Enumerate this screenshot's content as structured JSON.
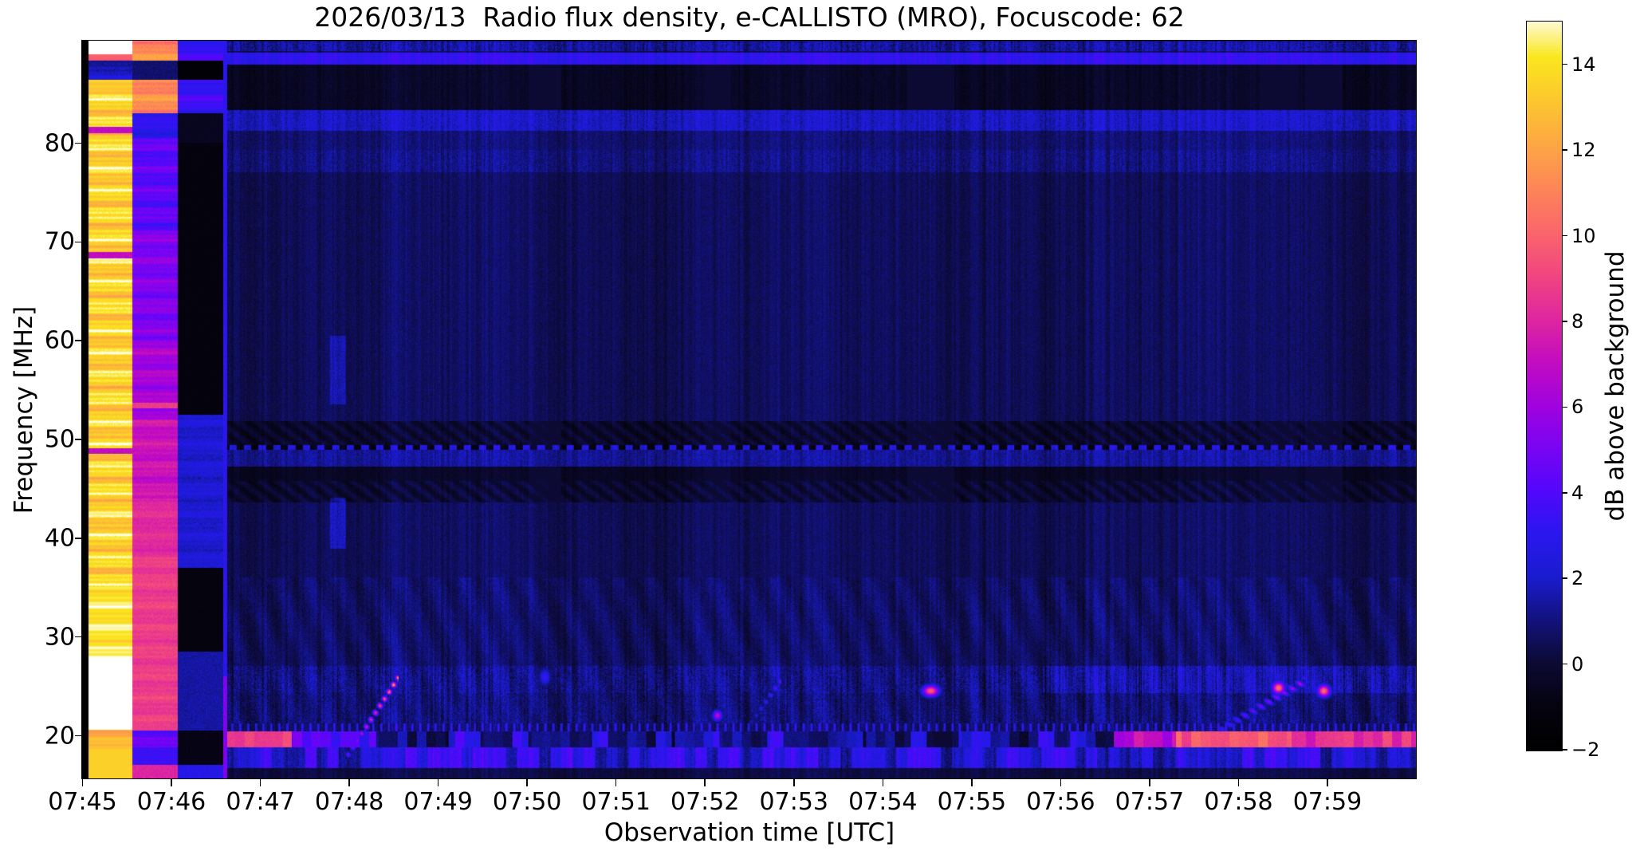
{
  "chart_data": {
    "type": "heatmap",
    "subtype": "radio-spectrogram",
    "title": "2026/03/13  Radio flux density, e-CALLISTO (MRO), Focuscode: 62",
    "xlabel": "Observation time [UTC]",
    "ylabel": "Frequency [MHz]",
    "colorbar_label": "dB above background",
    "x_tick_labels": [
      "07:45",
      "07:46",
      "07:47",
      "07:48",
      "07:49",
      "07:50",
      "07:51",
      "07:52",
      "07:53",
      "07:54",
      "07:55",
      "07:56",
      "07:57",
      "07:58",
      "07:59"
    ],
    "x_range_minutes": 15,
    "time_start": "07:45",
    "time_end": "08:00",
    "y_tick_values": [
      20,
      30,
      40,
      50,
      60,
      70,
      80
    ],
    "freq_range_mhz": [
      15.6,
      90.3
    ],
    "colorbar_tick_values": [
      14,
      12,
      10,
      8,
      6,
      4,
      2,
      0,
      -2
    ],
    "value_range_db": [
      -2,
      15
    ],
    "grid": false,
    "background_level_db": 0.55,
    "colormap_stops": [
      {
        "t": 0.0,
        "c": "#000000"
      },
      {
        "t": 0.06,
        "c": "#05030f"
      },
      {
        "t": 0.118,
        "c": "#0c0a33"
      },
      {
        "t": 0.176,
        "c": "#12127c"
      },
      {
        "t": 0.235,
        "c": "#1a1ccf"
      },
      {
        "t": 0.294,
        "c": "#2a17ef"
      },
      {
        "t": 0.353,
        "c": "#5407fb"
      },
      {
        "t": 0.412,
        "c": "#7b04f2"
      },
      {
        "t": 0.471,
        "c": "#a202dd"
      },
      {
        "t": 0.529,
        "c": "#c40dbf"
      },
      {
        "t": 0.588,
        "c": "#e0289e"
      },
      {
        "t": 0.647,
        "c": "#f1477f"
      },
      {
        "t": 0.706,
        "c": "#fb676b"
      },
      {
        "t": 0.765,
        "c": "#fd8756"
      },
      {
        "t": 0.824,
        "c": "#fda843"
      },
      {
        "t": 0.882,
        "c": "#fcc72e"
      },
      {
        "t": 0.941,
        "c": "#fae71e"
      },
      {
        "t": 1.0,
        "c": "#ffffff"
      }
    ],
    "features": {
      "calibration_columns": [
        {
          "t": [
            0.0,
            0.07
          ],
          "type": "black_edge"
        },
        {
          "t": [
            0.07,
            0.56
          ],
          "type": "saturated_white"
        },
        {
          "t": [
            0.56,
            1.07
          ],
          "type": "orange_magenta"
        },
        {
          "t": [
            1.07,
            1.58
          ],
          "type": "dark_blue_black"
        },
        {
          "t": [
            1.58,
            1.63
          ],
          "type": "blue_line"
        }
      ],
      "bands": [
        {
          "f": [
            89.3,
            90.3
          ],
          "amp": 0.9,
          "tex": 1.3
        },
        {
          "f": [
            87.9,
            89.1
          ],
          "amp": 2.6,
          "tex": 0.8
        },
        {
          "f": [
            83.3,
            87.9
          ],
          "amp": -0.9,
          "tex": 0.5
        },
        {
          "f": [
            81.2,
            83.3
          ],
          "amp": 1.4,
          "tex": 1.0
        },
        {
          "f": [
            79.3,
            81.2
          ],
          "amp": 0.3,
          "tex": 0.7
        },
        {
          "f": [
            77.0,
            79.3
          ],
          "amp": 0.5,
          "tex": 0.9
        },
        {
          "f": [
            51.8,
            77.0
          ],
          "amp": 0.0,
          "tex": 0.6
        },
        {
          "f": [
            49.4,
            51.8
          ],
          "amp": -0.35,
          "tex": 0.5,
          "herring": true
        },
        {
          "f": [
            48.9,
            49.4
          ],
          "amp": 0.5,
          "tex": 0.5,
          "dashed": true
        },
        {
          "f": [
            47.2,
            48.9
          ],
          "amp": 0.8,
          "tex": 0.8
        },
        {
          "f": [
            45.8,
            47.2
          ],
          "amp": -0.9,
          "tex": 0.4
        },
        {
          "f": [
            43.6,
            45.8
          ],
          "amp": -0.25,
          "tex": 0.5,
          "herring": true
        },
        {
          "f": [
            36.0,
            43.6
          ],
          "amp": 0.0,
          "tex": 0.6
        },
        {
          "f": [
            27.0,
            36.0
          ],
          "amp": 0.15,
          "tex": 0.8,
          "diag": true
        },
        {
          "f": [
            24.3,
            27.0
          ],
          "amp": 0.55,
          "tex": 1.3,
          "diag": true,
          "late_boost": 1.0
        },
        {
          "f": [
            21.2,
            24.3
          ],
          "amp": 0.35,
          "tex": 1.1,
          "diag": true
        },
        {
          "f": [
            20.4,
            21.2
          ],
          "amp": 0.6,
          "tex": 0.8,
          "blips": true
        },
        {
          "f": [
            18.8,
            20.4
          ],
          "amp": 0.0,
          "tex": 0.6,
          "lowband": true
        },
        {
          "f": [
            16.7,
            18.8
          ],
          "amp": 1.4,
          "tex": 1.0,
          "blocks": true
        },
        {
          "f": [
            15.6,
            16.7
          ],
          "amp": -0.3,
          "tex": 0.5
        }
      ],
      "lowband_segments": [
        {
          "t": [
            1.58,
            2.35
          ],
          "level": 9.0
        },
        {
          "t": [
            2.35,
            3.3
          ],
          "level": 4.0
        },
        {
          "t": [
            3.3,
            11.6
          ],
          "level": 0.8
        },
        {
          "t": [
            11.6,
            12.3
          ],
          "level": 7.0
        },
        {
          "t": [
            12.3,
            13.6
          ],
          "level": 9.8
        },
        {
          "t": [
            13.6,
            15.0
          ],
          "level": 8.3
        }
      ],
      "bursts": [
        {
          "t": [
            2.95,
            3.55
          ],
          "f": [
            17.5,
            25.8
          ],
          "amp": 12.0,
          "type": "typeIII"
        },
        {
          "t": [
            7.5,
            7.85
          ],
          "f": [
            21.0,
            25.5
          ],
          "amp": 4.5,
          "type": "typeIII"
        },
        {
          "t": [
            12.4,
            13.75
          ],
          "f": [
            18.5,
            25.5
          ],
          "amp": 6.5,
          "type": "typeIII"
        },
        {
          "t": [
            2.78,
            2.96
          ],
          "f": [
            53.5,
            60.5
          ],
          "amp": 1.4,
          "type": "smudge"
        },
        {
          "t": [
            2.78,
            2.96
          ],
          "f": [
            38.9,
            44.1
          ],
          "amp": 1.7,
          "type": "smudge"
        }
      ],
      "spots": [
        {
          "t": 5.2,
          "f": 25.9,
          "amp": 3.5,
          "wt": 0.06,
          "wf": 0.8
        },
        {
          "t": 7.14,
          "f": 22.0,
          "amp": 7.0,
          "wt": 0.05,
          "wf": 0.5
        },
        {
          "t": 9.54,
          "f": 24.5,
          "amp": 10.0,
          "wt": 0.09,
          "wf": 0.55
        },
        {
          "t": 13.45,
          "f": 24.8,
          "amp": 10.5,
          "wt": 0.07,
          "wf": 0.6
        },
        {
          "t": 13.96,
          "f": 24.5,
          "amp": 10.5,
          "wt": 0.07,
          "wf": 0.6
        }
      ]
    }
  }
}
